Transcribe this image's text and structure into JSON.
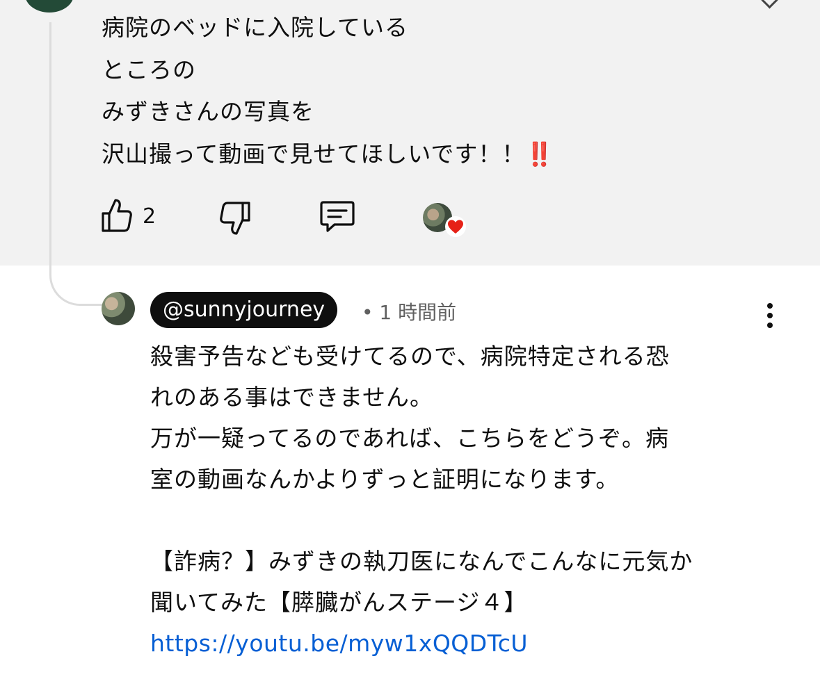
{
  "parent_comment": {
    "lines": [
      "病院のベッドに入院している",
      "ところの",
      "みずきさんの写真を",
      "沢山撮って動画で見せてほしいです！！"
    ],
    "emoji": "‼️",
    "like_count": "2"
  },
  "reply": {
    "handle": "@sunnyjourney",
    "time": "• 1 時間前",
    "lines": [
      "殺害予告なども受けてるので、病院特定される恐",
      "れのある事はできません。",
      "万が一疑ってるのであれば、こちらをどうぞ。病",
      "室の動画なんかよりずっと証明になります。",
      "",
      "【詐病？】みずきの執刀医になんでこんなに元気か",
      "聞いてみた【膵臓がんステージ４】"
    ],
    "link": "https://youtu.be/myw1xQQDTcU"
  },
  "icons": {
    "like": "thumbs-up-icon",
    "dislike": "thumbs-down-icon",
    "reply": "comment-icon",
    "creator_heart": "heart-icon",
    "more": "more-vert-icon"
  },
  "colors": {
    "parent_bg": "#f2f2f2",
    "link": "#065fd4",
    "heart": "#e62117",
    "handle_pill": "#0f0f0f"
  }
}
